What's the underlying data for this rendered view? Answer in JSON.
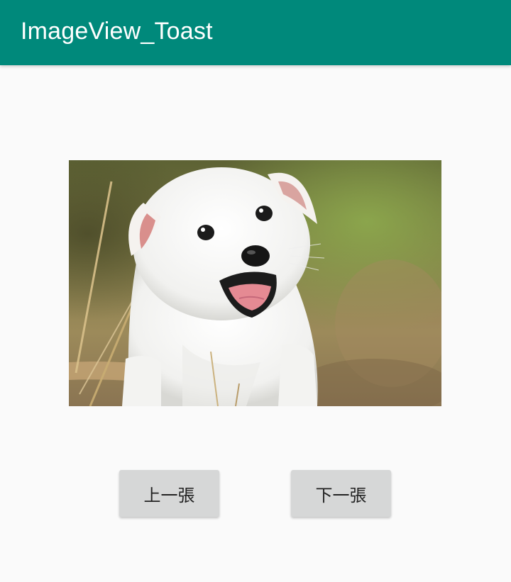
{
  "app_bar": {
    "title": "ImageView_Toast",
    "color": "#00897B"
  },
  "image": {
    "subject": "white-puppy-photo"
  },
  "buttons": {
    "prev_label": "上一張",
    "next_label": "下一張"
  },
  "colors": {
    "background": "#FAFAFA",
    "button_bg": "#D6D7D7",
    "button_text": "#222222"
  }
}
